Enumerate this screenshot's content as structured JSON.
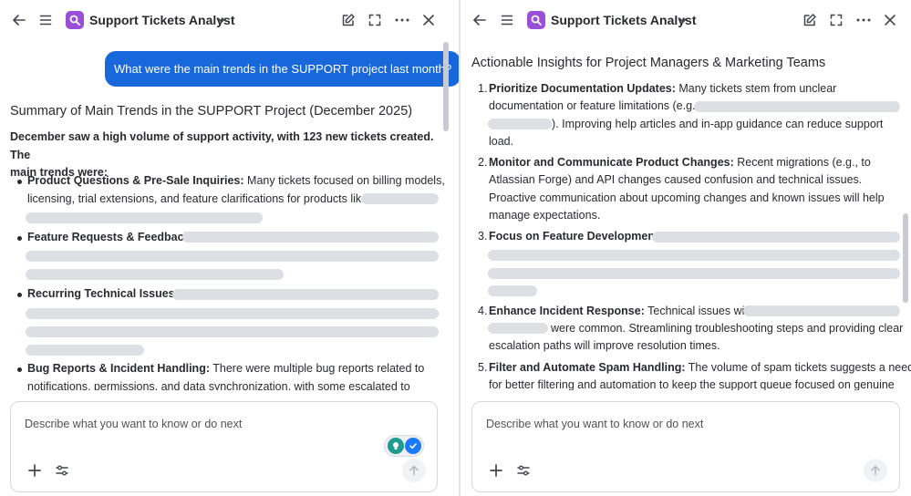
{
  "left": {
    "header": {
      "title": "Support Tickets Analyst"
    },
    "user_message": "What were the main trends in the SUPPORT project last month?",
    "response": {
      "title": "Summary of Main Trends in the SUPPORT Project (December 2025)",
      "intro_line1": "December saw a high volume of support activity, with 123 new tickets created. The",
      "intro_line2": "main trends were:",
      "bullets": [
        {
          "label": "Product Questions & Pre-Sale Inquiries:",
          "line1": " Many tickets focused on billing models,",
          "line2": "licensing, trial extensions, and feature clarifications for products like"
        },
        {
          "label": "Feature Requests & Feedback:"
        },
        {
          "label": "Recurring Technical Issues:"
        },
        {
          "label": "Bug Reports & Incident Handling:",
          "line1": " There were multiple bug reports related to",
          "line2": "notifications, permissions, and data synchronization, with some escalated to"
        }
      ]
    },
    "composer": {
      "placeholder": "Describe what you want to know or do next"
    }
  },
  "right": {
    "header": {
      "title": "Support Tickets Analyst"
    },
    "section_title": "Actionable Insights for Project Managers & Marketing Teams",
    "items": [
      {
        "num": "1.",
        "label": "Prioritize Documentation Updates:",
        "line1": " Many tickets stem from unclear",
        "line2": "documentation or feature limitations (e.g.,",
        "line3": "). Improving help articles and in-app guidance can reduce support",
        "line4": "load."
      },
      {
        "num": "2.",
        "label": "Monitor and Communicate Product Changes:",
        "line1": " Recent migrations (e.g., to",
        "line2": "Atlassian Forge) and API changes caused confusion and technical issues.",
        "line3": "Proactive communication about upcoming changes and known issues will help",
        "line4": "manage expectations."
      },
      {
        "num": "3.",
        "label": "Focus on Feature Development:"
      },
      {
        "num": "4.",
        "label": "Enhance Incident Response:",
        "line1": " Technical issues with",
        "line2": "were common. Streamlining troubleshooting steps and providing clear",
        "line3": "escalation paths will improve resolution times."
      },
      {
        "num": "5.",
        "label": "Filter and Automate Spam Handling:",
        "line1": " The volume of spam tickets suggests a need",
        "line2": "for better filtering and automation to keep the support queue focused on genuine"
      }
    ],
    "composer": {
      "placeholder": "Describe what you want to know or do next"
    }
  },
  "colors": {
    "accent": "#1868db",
    "logo": "#9a4fd8",
    "redaction": "#dcdfe4"
  }
}
